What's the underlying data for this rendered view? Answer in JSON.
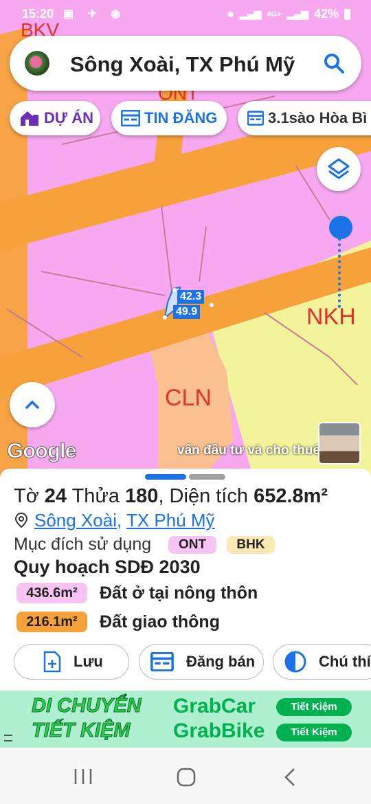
{
  "status_bar": {
    "time": "15:20",
    "battery": "42%",
    "network": "4G+"
  },
  "search": {
    "query": "Sông Xoài, TX Phú Mỹ"
  },
  "chips": [
    {
      "label": "DỰ ÁN",
      "color": "#6a2fb5"
    },
    {
      "label": "TIN ĐĂNG",
      "color": "#1a73e8"
    },
    {
      "label": "3.1sào Hòa Bì",
      "color": "#333333"
    }
  ],
  "map": {
    "zone_labels": [
      "ONT",
      "NKH",
      "CLN",
      "BKV"
    ],
    "measurements": [
      "42.3",
      "49.9"
    ],
    "google_logo": "Google",
    "ticker": "vấn đầu tư và cho thuê",
    "colors": {
      "ont_zone": "#f7a8f0",
      "road": "#f7a13a",
      "nkh_zone": "#f2f39a",
      "cln_zone": "#fbc08f"
    }
  },
  "parcel": {
    "title_prefix": "Tờ ",
    "sheet": "24",
    "title_mid": " Thửa ",
    "lot": "180",
    "area_prefix": ", Diện tích ",
    "area": "652.8m²",
    "location_ward": "Sông Xoài",
    "location_sep": ", ",
    "location_town": "TX Phú Mỹ",
    "purpose_label": "Mục đích sử dụng",
    "purpose_codes": [
      {
        "code": "ONT",
        "color": "#f8c4f4"
      },
      {
        "code": "BHK",
        "color": "#fbeab4"
      }
    ],
    "plan_title": "Quy hoạch SDĐ 2030",
    "plan_items": [
      {
        "area": "436.6m²",
        "label": "Đất ở tại nông thôn",
        "color": "#f8c4f4"
      },
      {
        "area": "216.1m²",
        "label": "Đất giao thông",
        "color": "#f7a13a"
      }
    ]
  },
  "actions": [
    {
      "label": "Lưu"
    },
    {
      "label": "Đăng bán"
    },
    {
      "label": "Chú thí"
    }
  ],
  "ad": {
    "line1": "DI CHUYỂN",
    "line2": "TIẾT KIỆM",
    "brand1": "GrabCar",
    "brand2": "GrabBike",
    "pill1": "Tiết Kiệm",
    "pill2": "Tiết Kiệm"
  }
}
